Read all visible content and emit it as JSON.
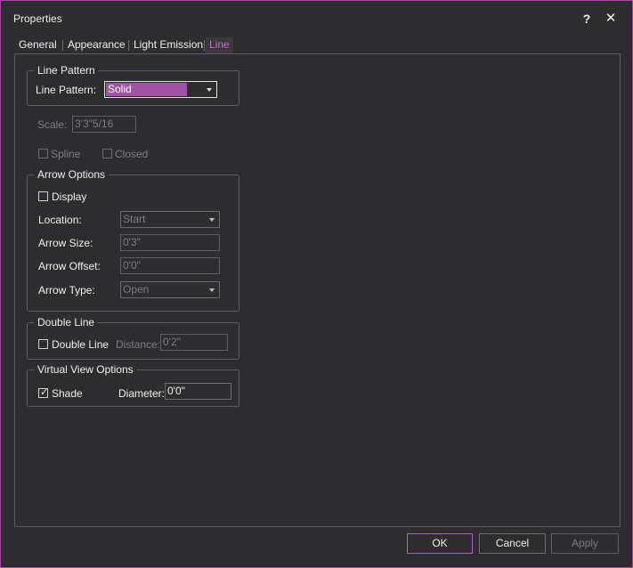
{
  "window": {
    "title": "Properties",
    "help_label": "?",
    "close_label": "✕",
    "accent": "#9b4f96"
  },
  "tabs": [
    {
      "label": "General",
      "active": false
    },
    {
      "label": "Appearance",
      "active": false
    },
    {
      "label": "Light Emission",
      "active": false
    },
    {
      "label": "Line",
      "active": true
    }
  ],
  "line_pattern": {
    "legend": "Line Pattern",
    "label": "Line Pattern:",
    "value": "Solid"
  },
  "scale": {
    "label": "Scale:",
    "value": "3'3\"5/16"
  },
  "spline": {
    "label": "Spline",
    "checked": false
  },
  "closed": {
    "label": "Closed",
    "checked": false
  },
  "arrow_options": {
    "legend": "Arrow Options",
    "display_label": "Display",
    "display_checked": false,
    "location_label": "Location:",
    "location_value": "Start",
    "size_label": "Arrow Size:",
    "size_value": "0'3\"",
    "offset_label": "Arrow Offset:",
    "offset_value": "0'0\"",
    "type_label": "Arrow Type:",
    "type_value": "Open"
  },
  "double_line": {
    "legend": "Double Line",
    "checkbox_label": "Double Line",
    "checked": false,
    "distance_label": "Distance:",
    "distance_value": "0'2\""
  },
  "virtual_view": {
    "legend": "Virtual View Options",
    "shade_label": "Shade",
    "shade_checked": true,
    "diameter_label": "Diameter:",
    "diameter_value": "0'0\""
  },
  "buttons": {
    "ok": "OK",
    "cancel": "Cancel",
    "apply": "Apply"
  }
}
